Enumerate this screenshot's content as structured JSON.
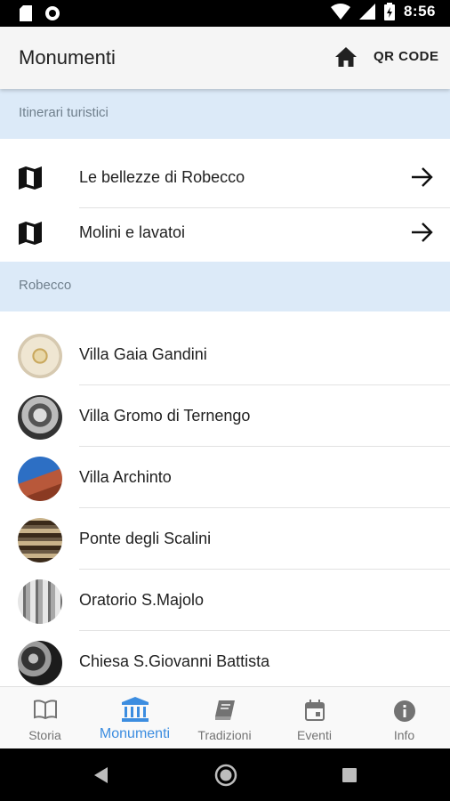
{
  "status": {
    "time": "8:56"
  },
  "appbar": {
    "title": "Monumenti",
    "qr_label": "QR CODE"
  },
  "sections": [
    {
      "label": "Itinerari turistici"
    },
    {
      "label": "Robecco"
    }
  ],
  "itineraries": [
    {
      "label": "Le bellezze di Robecco"
    },
    {
      "label": "Molini e lavatoi"
    }
  ],
  "monuments": [
    {
      "label": "Villa Gaia Gandini"
    },
    {
      "label": "Villa Gromo di Ternengo"
    },
    {
      "label": "Villa Archinto"
    },
    {
      "label": "Ponte degli Scalini"
    },
    {
      "label": "Oratorio S.Majolo"
    },
    {
      "label": "Chiesa S.Giovanni Battista"
    }
  ],
  "bottom_nav": [
    {
      "label": "Storia",
      "icon": "book-open-icon"
    },
    {
      "label": "Monumenti",
      "icon": "museum-icon",
      "active": true
    },
    {
      "label": "Tradizioni",
      "icon": "book-icon"
    },
    {
      "label": "Eventi",
      "icon": "calendar-icon"
    },
    {
      "label": "Info",
      "icon": "info-icon"
    }
  ],
  "colors": {
    "accent": "#3c8de0",
    "section_bg": "#dceaf8",
    "appbar_bg": "#f5f5f5"
  }
}
